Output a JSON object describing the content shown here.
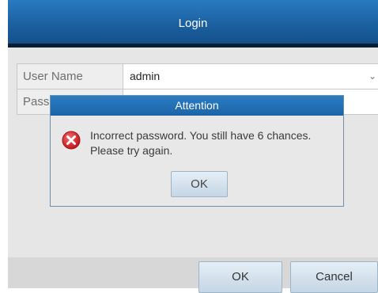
{
  "window": {
    "title": "Login"
  },
  "form": {
    "username_label": "User Name",
    "username_value": "admin",
    "password_label": "Pass"
  },
  "buttons": {
    "ok_label": "OK",
    "cancel_label": "Cancel"
  },
  "dialog": {
    "title": "Attention",
    "icon": "error-icon",
    "message": "Incorrect password. You still have 6 chances. Please try again.",
    "ok_label": "OK"
  },
  "colors": {
    "title_bar": "#1a5f9f",
    "error_red": "#d8262c",
    "button_face": "#c5d6e5"
  }
}
